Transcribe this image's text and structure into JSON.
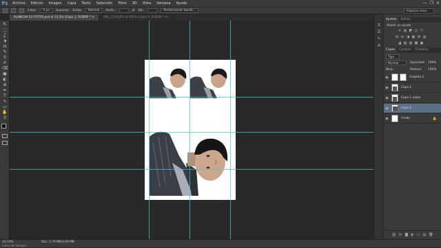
{
  "app": {
    "logo": "Ps"
  },
  "menu": [
    "Archivo",
    "Edición",
    "Imagen",
    "Capa",
    "Texto",
    "Selección",
    "Filtro",
    "3D",
    "Vista",
    "Ventana",
    "Ayuda"
  ],
  "window_controls": {
    "minimize": "—",
    "restore": "❐",
    "close": "✕"
  },
  "options": {
    "feather_label": "Calar:",
    "feather_value": "0 px",
    "antialias_label": "Suavizar",
    "style_label": "Estilo:",
    "style_value": "Normal",
    "width_label": "Anch.:",
    "height_label": "Alt.:",
    "refine_button": "Perfeccionar borde...",
    "workspace": "Espacio esen."
  },
  "tabs": [
    {
      "label": "PLANCHA 03 FOTOS.psd al 33,3% (Capa 1, RGB/8) *",
      "active": true
    },
    {
      "label": "IMG_1234.JPG al 100% (Capa 0, RGB/8) *",
      "active": false
    }
  ],
  "tools": [
    "⇱",
    "⬚",
    "ʆ",
    "⬗",
    "⊡",
    "✎",
    "⚲",
    "✐",
    "⌫",
    "▣",
    "◐",
    "⊕",
    "✒",
    "T",
    "⇖",
    "▭",
    "✋",
    "⚲"
  ],
  "status": {
    "zoom": "33,33%",
    "doc": "Doc: 1,79 MB/3,46 MB"
  },
  "bottom_tab": "Línea de tiempo",
  "adjustments": {
    "tabs": [
      "Ajustes",
      "Estilos"
    ],
    "title": "Añadir un ajuste",
    "icons_row1": [
      "☀",
      "▥",
      "◩",
      "◫",
      "▽"
    ],
    "icons_row2": [
      "⊟",
      "⚖",
      "◑",
      "▦",
      "⊞",
      "▤"
    ],
    "icons_row3": [
      "◪",
      "▧",
      "▨",
      "▩",
      "▣"
    ]
  },
  "layers_panel": {
    "tabs": [
      "Capas",
      "Canales",
      "Trazados"
    ],
    "kind_label": "Tipo",
    "blend_mode": "Normal",
    "opacity_label": "Opacidad:",
    "opacity_value": "100%",
    "lock_label": "Bloq.:",
    "fill_label": "Relleno:",
    "fill_value": "100%",
    "layers": [
      {
        "name": "Carpeta 1",
        "selected": false,
        "lock": ""
      },
      {
        "name": "Capa 1",
        "selected": false,
        "lock": ""
      },
      {
        "name": "Capa 1 copia",
        "selected": false,
        "lock": ""
      },
      {
        "name": "Capa 2",
        "selected": true,
        "lock": ""
      },
      {
        "name": "Fondo",
        "selected": false,
        "lock": "🔒"
      }
    ],
    "footer_icons": [
      "⛓",
      "fx",
      "◙",
      "◐",
      "▭",
      "▤",
      "🗑"
    ]
  },
  "colors": {
    "guide": "#3fc7d6",
    "selected_layer": "#5b6f87",
    "accent": "#4ba8e6"
  }
}
